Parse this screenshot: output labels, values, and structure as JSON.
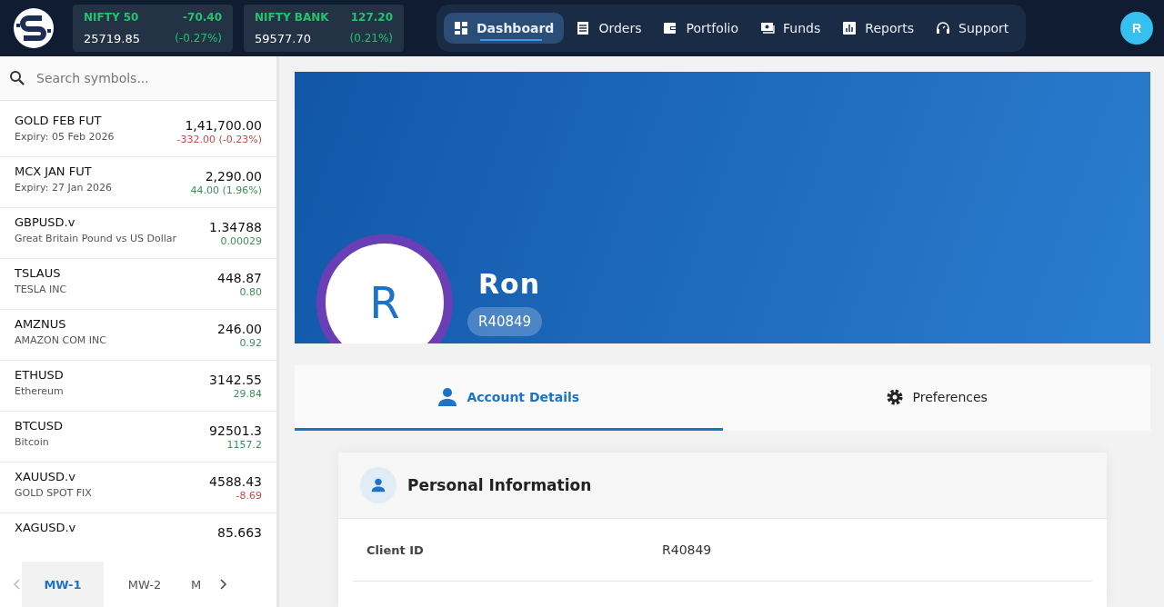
{
  "indices": [
    {
      "name": "NIFTY 50",
      "change": "-70.40",
      "value": "25719.85",
      "percent": "(-0.27%)"
    },
    {
      "name": "NIFTY BANK",
      "change": "127.20",
      "value": "59577.70",
      "percent": "(0.21%)"
    }
  ],
  "nav": [
    {
      "label": "Dashboard",
      "selected": true
    },
    {
      "label": "Orders",
      "selected": false
    },
    {
      "label": "Portfolio",
      "selected": false
    },
    {
      "label": "Funds",
      "selected": false
    },
    {
      "label": "Reports",
      "selected": false
    },
    {
      "label": "Support",
      "selected": false
    }
  ],
  "user_avatar": "R",
  "search": {
    "placeholder": "Search symbols..."
  },
  "watchlist": [
    {
      "symbol": "GOLD FEB FUT",
      "subtitle": "Expiry: 05 Feb 2026",
      "price": "1,41,700.00",
      "change": "-332.00 (-0.23%)",
      "color": "#c84a4a"
    },
    {
      "symbol": "MCX JAN FUT",
      "subtitle": "Expiry: 27 Jan 2026",
      "price": "2,290.00",
      "change": "44.00 (1.96%)",
      "color": "#3f8f5a"
    },
    {
      "symbol": "GBPUSD.v",
      "subtitle": "Great Britain Pound vs US Dollar",
      "price": "1.34788",
      "change": "0.00029",
      "color": "#3f8f5a"
    },
    {
      "symbol": "TSLAUS",
      "subtitle": "TESLA INC",
      "price": "448.87",
      "change": "0.80",
      "color": "#3f8f5a"
    },
    {
      "symbol": "AMZNUS",
      "subtitle": "AMAZON COM INC",
      "price": "246.00",
      "change": "0.92",
      "color": "#3f8f5a"
    },
    {
      "symbol": "ETHUSD",
      "subtitle": "Ethereum",
      "price": "3142.55",
      "change": "29.84",
      "color": "#3f8f5a"
    },
    {
      "symbol": "BTCUSD",
      "subtitle": "Bitcoin",
      "price": "92501.3",
      "change": "1157.2",
      "color": "#3f8f5a"
    },
    {
      "symbol": "XAUUSD.v",
      "subtitle": "GOLD SPOT FIX",
      "price": "4588.43",
      "change": "-8.69",
      "color": "#c84a4a"
    },
    {
      "symbol": "XAGUSD.v",
      "price": "85.663"
    }
  ],
  "watchlist_tabs": [
    {
      "label": "MW-1",
      "selected": true
    },
    {
      "label": "MW-2",
      "selected": false
    },
    {
      "label": "M",
      "selected": false
    }
  ],
  "profile": {
    "initial": "R",
    "name": "Ron",
    "client_id": "R40849"
  },
  "profile_tabs": [
    {
      "label": "Account Details",
      "selected": true
    },
    {
      "label": "Preferences",
      "selected": false
    }
  ],
  "personal_information": {
    "title": "Personal Information",
    "fields": [
      {
        "label": "Client ID",
        "value": "R40849"
      }
    ]
  }
}
